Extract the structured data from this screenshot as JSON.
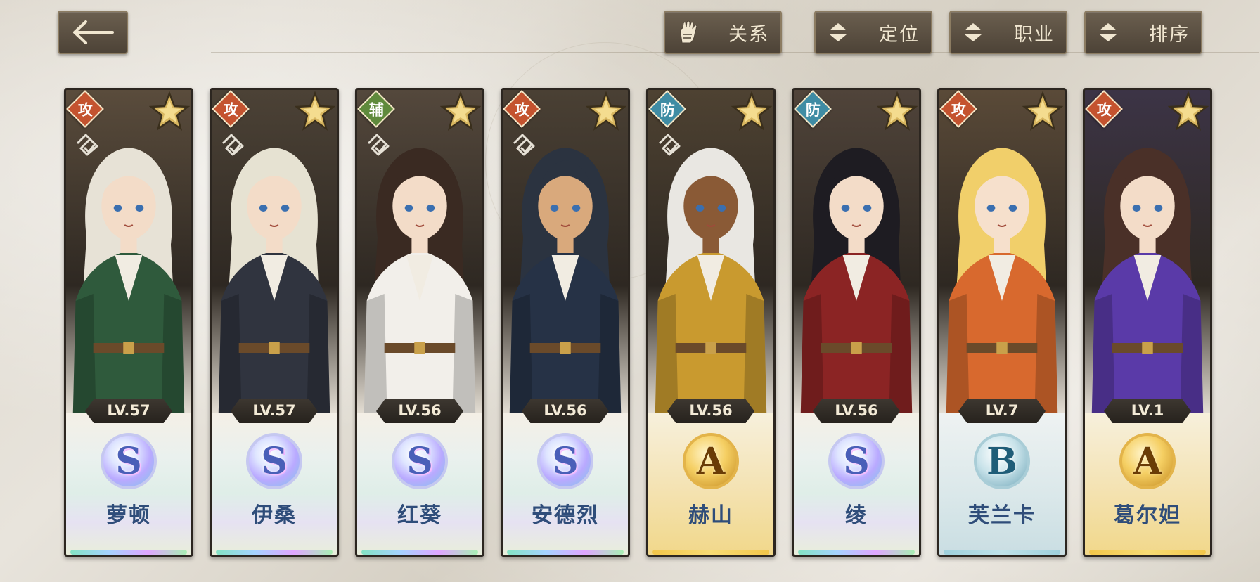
{
  "header": {
    "back_icon": "back-arrow-icon",
    "filters": [
      {
        "label": "关系",
        "icon": "glove-icon"
      },
      {
        "label": "定位",
        "icon": "sort-arrows-icon"
      },
      {
        "label": "职业",
        "icon": "sort-arrows-icon"
      },
      {
        "label": "排序",
        "icon": "sort-arrows-icon"
      }
    ]
  },
  "characters": [
    {
      "name": "萝顿",
      "level": "LV.57",
      "rank": "S",
      "role": "攻",
      "role_type": "attack",
      "has_tag": true,
      "hair": "#e7e2d6",
      "outfit": "#2f5a3c",
      "skin": "#f3dcc8",
      "bg": "#5a4c3c"
    },
    {
      "name": "伊桑",
      "level": "LV.57",
      "rank": "S",
      "role": "攻",
      "role_type": "attack",
      "has_tag": true,
      "hair": "#e6e2d2",
      "outfit": "#30343f",
      "skin": "#f3dcc8",
      "bg": "#4c4236"
    },
    {
      "name": "红葵",
      "level": "LV.56",
      "rank": "S",
      "role": "辅",
      "role_type": "support",
      "has_tag": true,
      "hair": "#3a2a22",
      "outfit": "#f2efea",
      "skin": "#f3dcc8",
      "bg": "#54483c"
    },
    {
      "name": "安德烈",
      "level": "LV.56",
      "rank": "S",
      "role": "攻",
      "role_type": "attack",
      "has_tag": true,
      "hair": "#2b3340",
      "outfit": "#263246",
      "skin": "#d9a97c",
      "bg": "#4a4034"
    },
    {
      "name": "赫山",
      "level": "LV.56",
      "rank": "A",
      "role": "防",
      "role_type": "defense",
      "has_tag": true,
      "hair": "#e9e7e2",
      "outfit": "#c99a2f",
      "skin": "#8a5a36",
      "bg": "#4e4232"
    },
    {
      "name": "绫",
      "level": "LV.56",
      "rank": "S",
      "role": "防",
      "role_type": "defense",
      "has_tag": false,
      "hair": "#1e1c22",
      "outfit": "#8b2424",
      "skin": "#f3dcc8",
      "bg": "#50443a"
    },
    {
      "name": "芙兰卡",
      "level": "LV.7",
      "rank": "B",
      "role": "攻",
      "role_type": "attack",
      "has_tag": false,
      "hair": "#f1cf6a",
      "outfit": "#d8692e",
      "skin": "#f6e0cc",
      "bg": "#5a4a38"
    },
    {
      "name": "葛尔妲",
      "level": "LV.1",
      "rank": "A",
      "role": "攻",
      "role_type": "attack",
      "has_tag": false,
      "hair": "#4a3028",
      "outfit": "#5a3aa8",
      "skin": "#f3dcc8",
      "bg": "#3c3446"
    }
  ]
}
